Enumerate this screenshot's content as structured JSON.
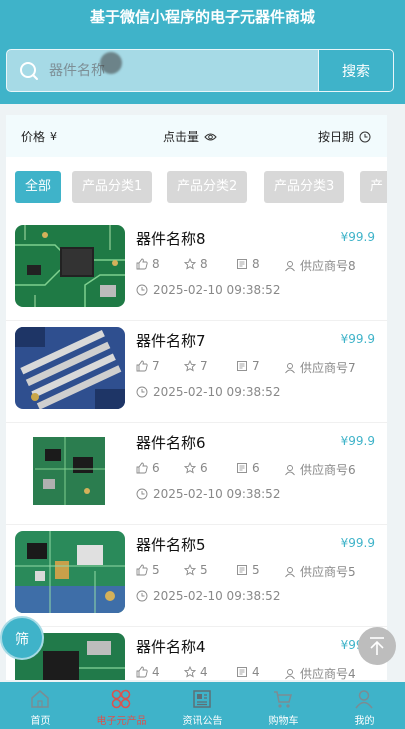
{
  "app": {
    "title": "基于微信小程序的电子元器件商城"
  },
  "search": {
    "placeholder": "器件名称",
    "button_label": "搜索"
  },
  "sort_bar": {
    "price_label": "价格",
    "price_symbol": "¥",
    "clicks_label": "点击量",
    "date_label": "按日期"
  },
  "categories": [
    {
      "label": "全部",
      "active": true
    },
    {
      "label": "产品分类1",
      "active": false
    },
    {
      "label": "产品分类2",
      "active": false
    },
    {
      "label": "产品分类3",
      "active": false
    },
    {
      "label": "产",
      "active": false
    }
  ],
  "products": [
    {
      "name": "器件名称8",
      "price": "¥99.9",
      "likes": "8",
      "favorites": "8",
      "comments": "8",
      "supplier": "供应商号8",
      "time": "2025-02-10 09:38:52",
      "image": "circuit-board"
    },
    {
      "name": "器件名称7",
      "price": "¥99.9",
      "likes": "7",
      "favorites": "7",
      "comments": "7",
      "supplier": "供应商号7",
      "time": "2025-02-10 09:38:52",
      "image": "motherboard-slots"
    },
    {
      "name": "器件名称6",
      "price": "¥99.9",
      "likes": "6",
      "favorites": "6",
      "comments": "6",
      "supplier": "供应商号6",
      "time": "2025-02-10 09:38:52",
      "image": "small-pcb"
    },
    {
      "name": "器件名称5",
      "price": "¥99.9",
      "likes": "5",
      "favorites": "5",
      "comments": "5",
      "supplier": "供应商号5",
      "time": "2025-02-10 09:38:52",
      "image": "component-board"
    },
    {
      "name": "器件名称4",
      "price": "¥99.9",
      "likes": "4",
      "favorites": "4",
      "comments": "4",
      "supplier": "供应商号4",
      "time": "",
      "image": "chip-board"
    }
  ],
  "floating": {
    "filter_label": "筛",
    "top_icon": "arrow-up-to-top-icon"
  },
  "tab_bar": [
    {
      "label": "首页",
      "icon": "home-icon",
      "active": false
    },
    {
      "label": "电子元产品",
      "icon": "grid-icon",
      "active": true
    },
    {
      "label": "资讯公告",
      "icon": "news-icon",
      "active": false
    },
    {
      "label": "购物车",
      "icon": "cart-icon",
      "active": false
    },
    {
      "label": "我的",
      "icon": "user-icon",
      "active": false
    }
  ],
  "colors": {
    "primary": "#3fb3c9",
    "price": "#3fb3c9",
    "active_tab": "#d9534f",
    "inactive_category": "#d8d8d8"
  }
}
